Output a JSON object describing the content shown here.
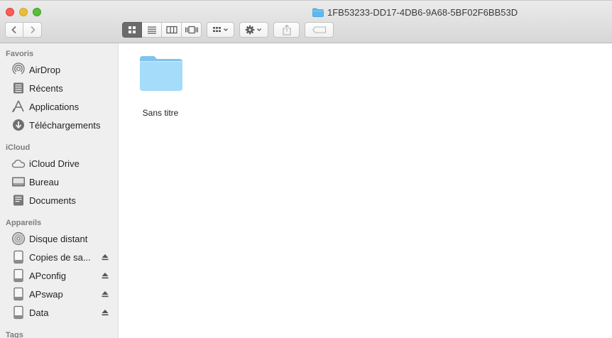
{
  "window": {
    "title": "1FB53233-DD17-4DB6-9A68-5BF02F6BB53D"
  },
  "toolbar": {
    "back_icon": "chevron-left-icon",
    "forward_icon": "chevron-right-icon",
    "views": [
      "icon-view",
      "list-view",
      "column-view",
      "cover-flow-view"
    ],
    "selected_view": "icon-view",
    "arrange_icon": "arrange-grid-icon",
    "action_icon": "gear-icon",
    "share_icon": "share-icon",
    "tag_icon": "tag-icon"
  },
  "sidebar": {
    "sections": {
      "favorites": "Favoris",
      "icloud": "iCloud",
      "devices": "Appareils",
      "tags": "Tags"
    },
    "favorites": [
      {
        "label": "AirDrop",
        "icon": "airdrop-icon"
      },
      {
        "label": "Récents",
        "icon": "recents-icon"
      },
      {
        "label": "Applications",
        "icon": "applications-icon"
      },
      {
        "label": "Téléchargements",
        "icon": "downloads-icon"
      }
    ],
    "icloud": [
      {
        "label": "iCloud Drive",
        "icon": "cloud-icon"
      },
      {
        "label": "Bureau",
        "icon": "desktop-icon"
      },
      {
        "label": "Documents",
        "icon": "documents-icon"
      }
    ],
    "devices": [
      {
        "label": "Disque distant",
        "icon": "optical-disc-icon",
        "eject": false
      },
      {
        "label": "Copies de sa...",
        "icon": "drive-icon",
        "eject": true
      },
      {
        "label": "APconfig",
        "icon": "drive-icon",
        "eject": true
      },
      {
        "label": "APswap",
        "icon": "drive-icon",
        "eject": true
      },
      {
        "label": "Data",
        "icon": "drive-icon",
        "eject": true
      }
    ]
  },
  "content": {
    "items": [
      {
        "label": "Sans titre",
        "icon": "folder-icon"
      }
    ]
  },
  "colors": {
    "folder": "#8fd0f5",
    "sidebar_bg": "#f0eff0",
    "close": "#fc5b57",
    "minimize": "#e5bf3c",
    "maximize": "#57c038"
  }
}
